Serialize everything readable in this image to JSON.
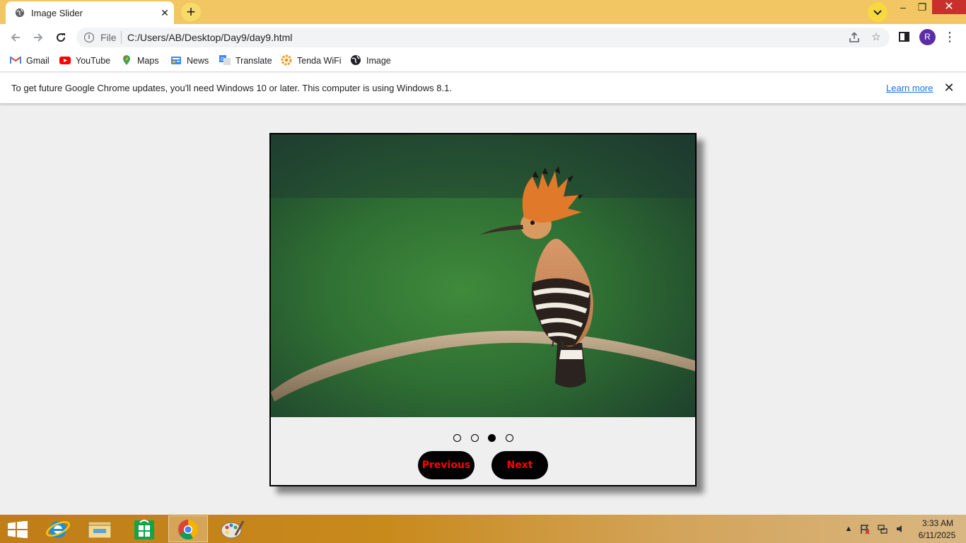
{
  "browser": {
    "tab": {
      "title": "Image Slider",
      "favicon": "globe-icon",
      "close_glyph": "✕"
    },
    "new_tab_glyph": "+",
    "window": {
      "minimize": "–",
      "maximize": "❐",
      "close": "✕"
    },
    "omnibox": {
      "scheme_label": "File",
      "url": "C:/Users/AB/Desktop/Day9/day9.html"
    },
    "profile_initial": "R",
    "accent_color": "#f2c763"
  },
  "bookmarks": [
    {
      "label": "Gmail",
      "icon": "gmail-icon"
    },
    {
      "label": "YouTube",
      "icon": "youtube-icon"
    },
    {
      "label": "Maps",
      "icon": "maps-icon"
    },
    {
      "label": "News",
      "icon": "news-icon"
    },
    {
      "label": "Translate",
      "icon": "translate-icon"
    },
    {
      "label": "Tenda WiFi",
      "icon": "tenda-icon"
    },
    {
      "label": "Image",
      "icon": "globe-icon"
    }
  ],
  "infobar": {
    "message": "To get future Google Chrome updates, you'll need Windows 10 or later. This computer is using Windows 8.1.",
    "link": "Learn more",
    "close_glyph": "✕"
  },
  "slider": {
    "image_subject": "hoopoe bird on a branch",
    "dots_count": 4,
    "active_index": 2,
    "prev_label": "Previous",
    "next_label": "Next",
    "button_text_color": "#ff0000"
  },
  "taskbar": {
    "apps": [
      "start-icon",
      "internet-explorer-icon",
      "file-explorer-icon",
      "store-icon",
      "chrome-icon",
      "paint-icon"
    ],
    "time": "3:33 AM",
    "date": "6/11/2025"
  }
}
